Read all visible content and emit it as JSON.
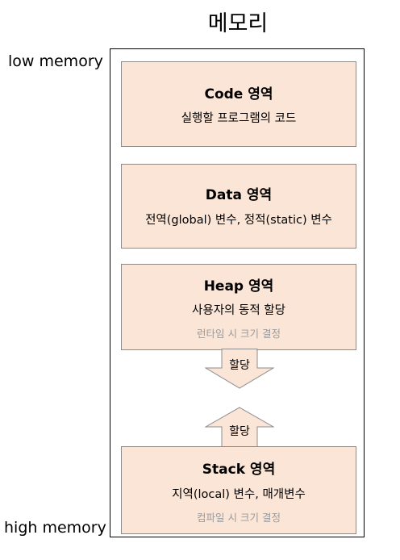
{
  "title": "메모리",
  "labels": {
    "low": "low memory",
    "high": "high memory"
  },
  "segments": {
    "code": {
      "title": "Code 영역",
      "desc": "실행할 프로그램의 코드"
    },
    "data": {
      "title": "Data 영역",
      "desc": "전역(global) 변수, 정적(static) 변수"
    },
    "heap": {
      "title": "Heap 영역",
      "desc": "사용자의 동적 할당",
      "note": "런타임 시 크기 결정"
    },
    "stack": {
      "title": "Stack 영역",
      "desc": "지역(local) 변수, 매개변수",
      "note": "컴파일 시 크기 결정"
    }
  },
  "arrows": {
    "down_label": "할당",
    "up_label": "할당"
  },
  "colors": {
    "segment_fill": "#fbe5d6",
    "segment_border": "#8c8c8c",
    "note_text": "#9a9a9a"
  }
}
